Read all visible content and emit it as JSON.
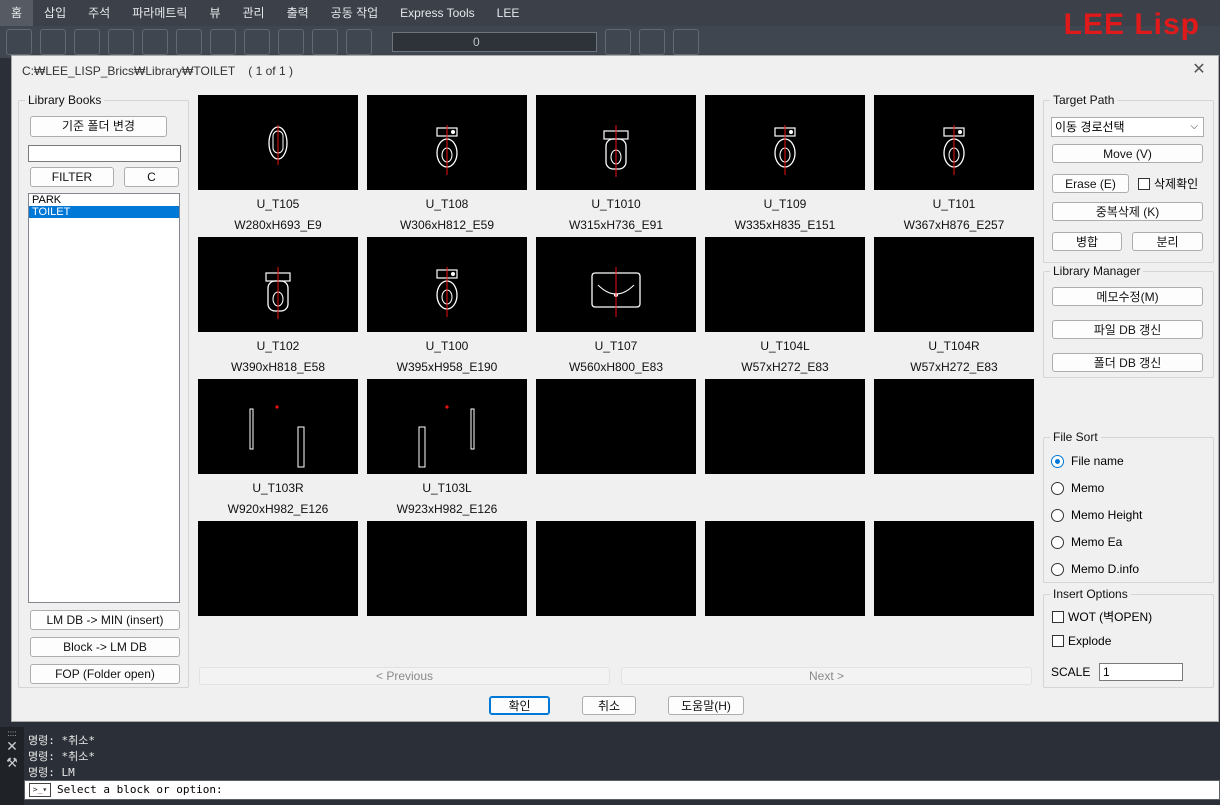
{
  "ribbon": {
    "tabs": [
      "홈",
      "삽입",
      "주석",
      "파라메트릭",
      "뷰",
      "관리",
      "출력",
      "공동 작업",
      "Express Tools",
      "LEE"
    ],
    "layer_value": "0",
    "brand": "LEE Lisp"
  },
  "dialog": {
    "title": "C:₩LEE_LISP_Brics₩Library₩TOILET",
    "page_info": "( 1 of 1 )",
    "close": "✕"
  },
  "library_books": {
    "label": "Library Books",
    "change_folder_button": "기준 폴더 변경",
    "filter_value": "",
    "filter_button": "FILTER",
    "clear_button": "C",
    "items": [
      {
        "label": "PARK",
        "selected": false
      },
      {
        "label": "TOILET",
        "selected": true
      }
    ],
    "lm_to_min_button": "LM DB -> MIN (insert)",
    "block_to_lm_button": "Block -> LM DB",
    "fop_button": "FOP (Folder open)"
  },
  "grid": {
    "items": [
      {
        "name": "U_T105",
        "size": "W280xH693_E9",
        "symbol": "urinal"
      },
      {
        "name": "U_T108",
        "size": "W306xH812_E59",
        "symbol": "toilet-valve"
      },
      {
        "name": "U_T1010",
        "size": "W315xH736_E91",
        "symbol": "toilet-tank"
      },
      {
        "name": "U_T109",
        "size": "W335xH835_E151",
        "symbol": "toilet-valve"
      },
      {
        "name": "U_T101",
        "size": "W367xH876_E257",
        "symbol": "toilet-valve"
      },
      {
        "name": "U_T102",
        "size": "W390xH818_E58",
        "symbol": "toilet-tank"
      },
      {
        "name": "U_T100",
        "size": "W395xH958_E190",
        "symbol": "toilet-valve"
      },
      {
        "name": "U_T107",
        "size": "W560xH800_E83",
        "symbol": "basin"
      },
      {
        "name": "U_T104L",
        "size": "W57xH272_E83",
        "symbol": "empty"
      },
      {
        "name": "U_T104R",
        "size": "W57xH272_E83",
        "symbol": "empty"
      },
      {
        "name": "U_T103R",
        "size": "W920xH982_E126",
        "symbol": "grab-bar-r"
      },
      {
        "name": "U_T103L",
        "size": "W923xH982_E126",
        "symbol": "grab-bar-l"
      }
    ],
    "previous_button": "< Previous",
    "next_button": "Next >"
  },
  "target_path": {
    "label": "Target Path",
    "selected": "이동 경로선택",
    "move_button": "Move (V)",
    "erase_button": "Erase (E)",
    "delete_confirm_label": "삭제확인",
    "dedupe_button": "중복삭제 (K)",
    "merge_button": "병합",
    "split_button": "분리"
  },
  "library_manager": {
    "label": "Library Manager",
    "memo_edit_button": "메모수정(M)",
    "file_db_button": "파일 DB 갱신",
    "folder_db_button": "폴더 DB 갱신"
  },
  "file_sort": {
    "label": "File Sort",
    "options": [
      {
        "label": "File name",
        "checked": true
      },
      {
        "label": "Memo",
        "checked": false
      },
      {
        "label": "Memo Height",
        "checked": false
      },
      {
        "label": "Memo Ea",
        "checked": false
      },
      {
        "label": "Memo D.info",
        "checked": false
      }
    ]
  },
  "insert_options": {
    "label": "Insert Options",
    "wot_label": "WOT (벽OPEN)",
    "explode_label": "Explode",
    "scale_label": "SCALE",
    "scale_value": "1"
  },
  "footer": {
    "ok_button": "확인",
    "cancel_button": "취소",
    "help_button": "도움말(H)"
  },
  "command_line": {
    "history": [
      "명령: *취소*",
      "명령: *취소*",
      "명령: LM"
    ],
    "prompt": "Select a block or option:"
  }
}
